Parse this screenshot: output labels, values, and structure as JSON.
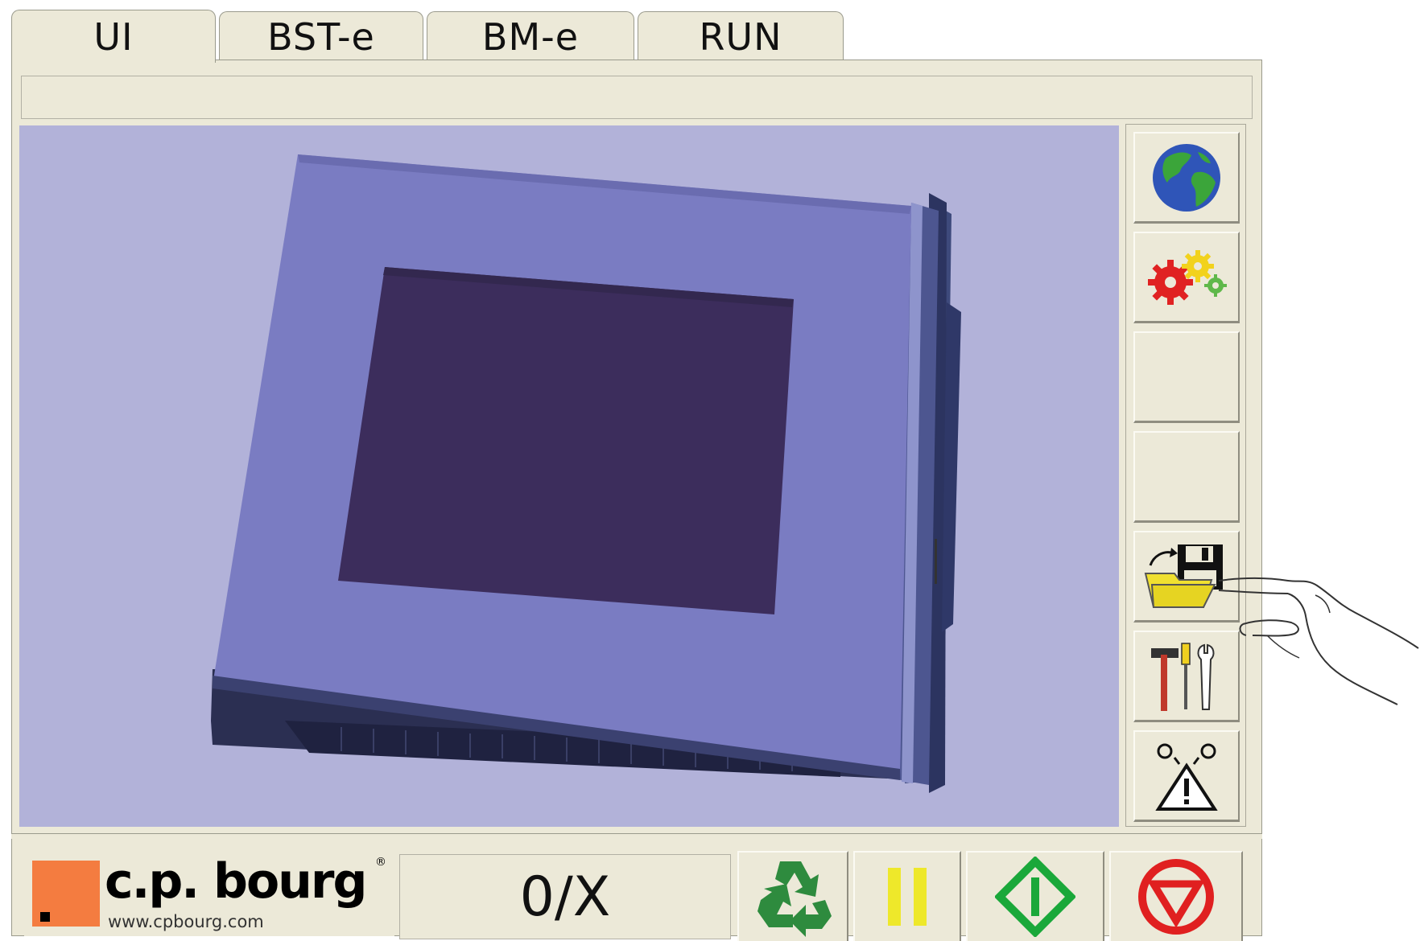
{
  "tabs": [
    {
      "label": "UI",
      "active": true
    },
    {
      "label": "BST-e",
      "active": false
    },
    {
      "label": "BM-e",
      "active": false
    },
    {
      "label": "RUN",
      "active": false
    }
  ],
  "status_text": "",
  "sidebar": {
    "buttons": [
      {
        "icon": "globe-icon"
      },
      {
        "icon": "gears-icon"
      },
      {
        "icon": ""
      },
      {
        "icon": ""
      },
      {
        "icon": "load-save-icon"
      },
      {
        "icon": "tools-icon"
      },
      {
        "icon": "warning-icon"
      }
    ]
  },
  "footer": {
    "logo_name": "c.p. bourg",
    "logo_url": "www.cpbourg.com",
    "logo_reg": "®",
    "counter": "0/X",
    "buttons": [
      {
        "icon": "recycle-icon",
        "color": "#2e8b3e"
      },
      {
        "icon": "pause-icon",
        "color": "#eee82a"
      },
      {
        "icon": "start-icon",
        "color": "#1aa83a"
      },
      {
        "icon": "stop-icon",
        "color": "#e02020"
      }
    ]
  },
  "colors": {
    "viewport_bg": "#b2b2d9",
    "panel_bg": "#ece9d8",
    "logo_orange": "#f47c40"
  }
}
